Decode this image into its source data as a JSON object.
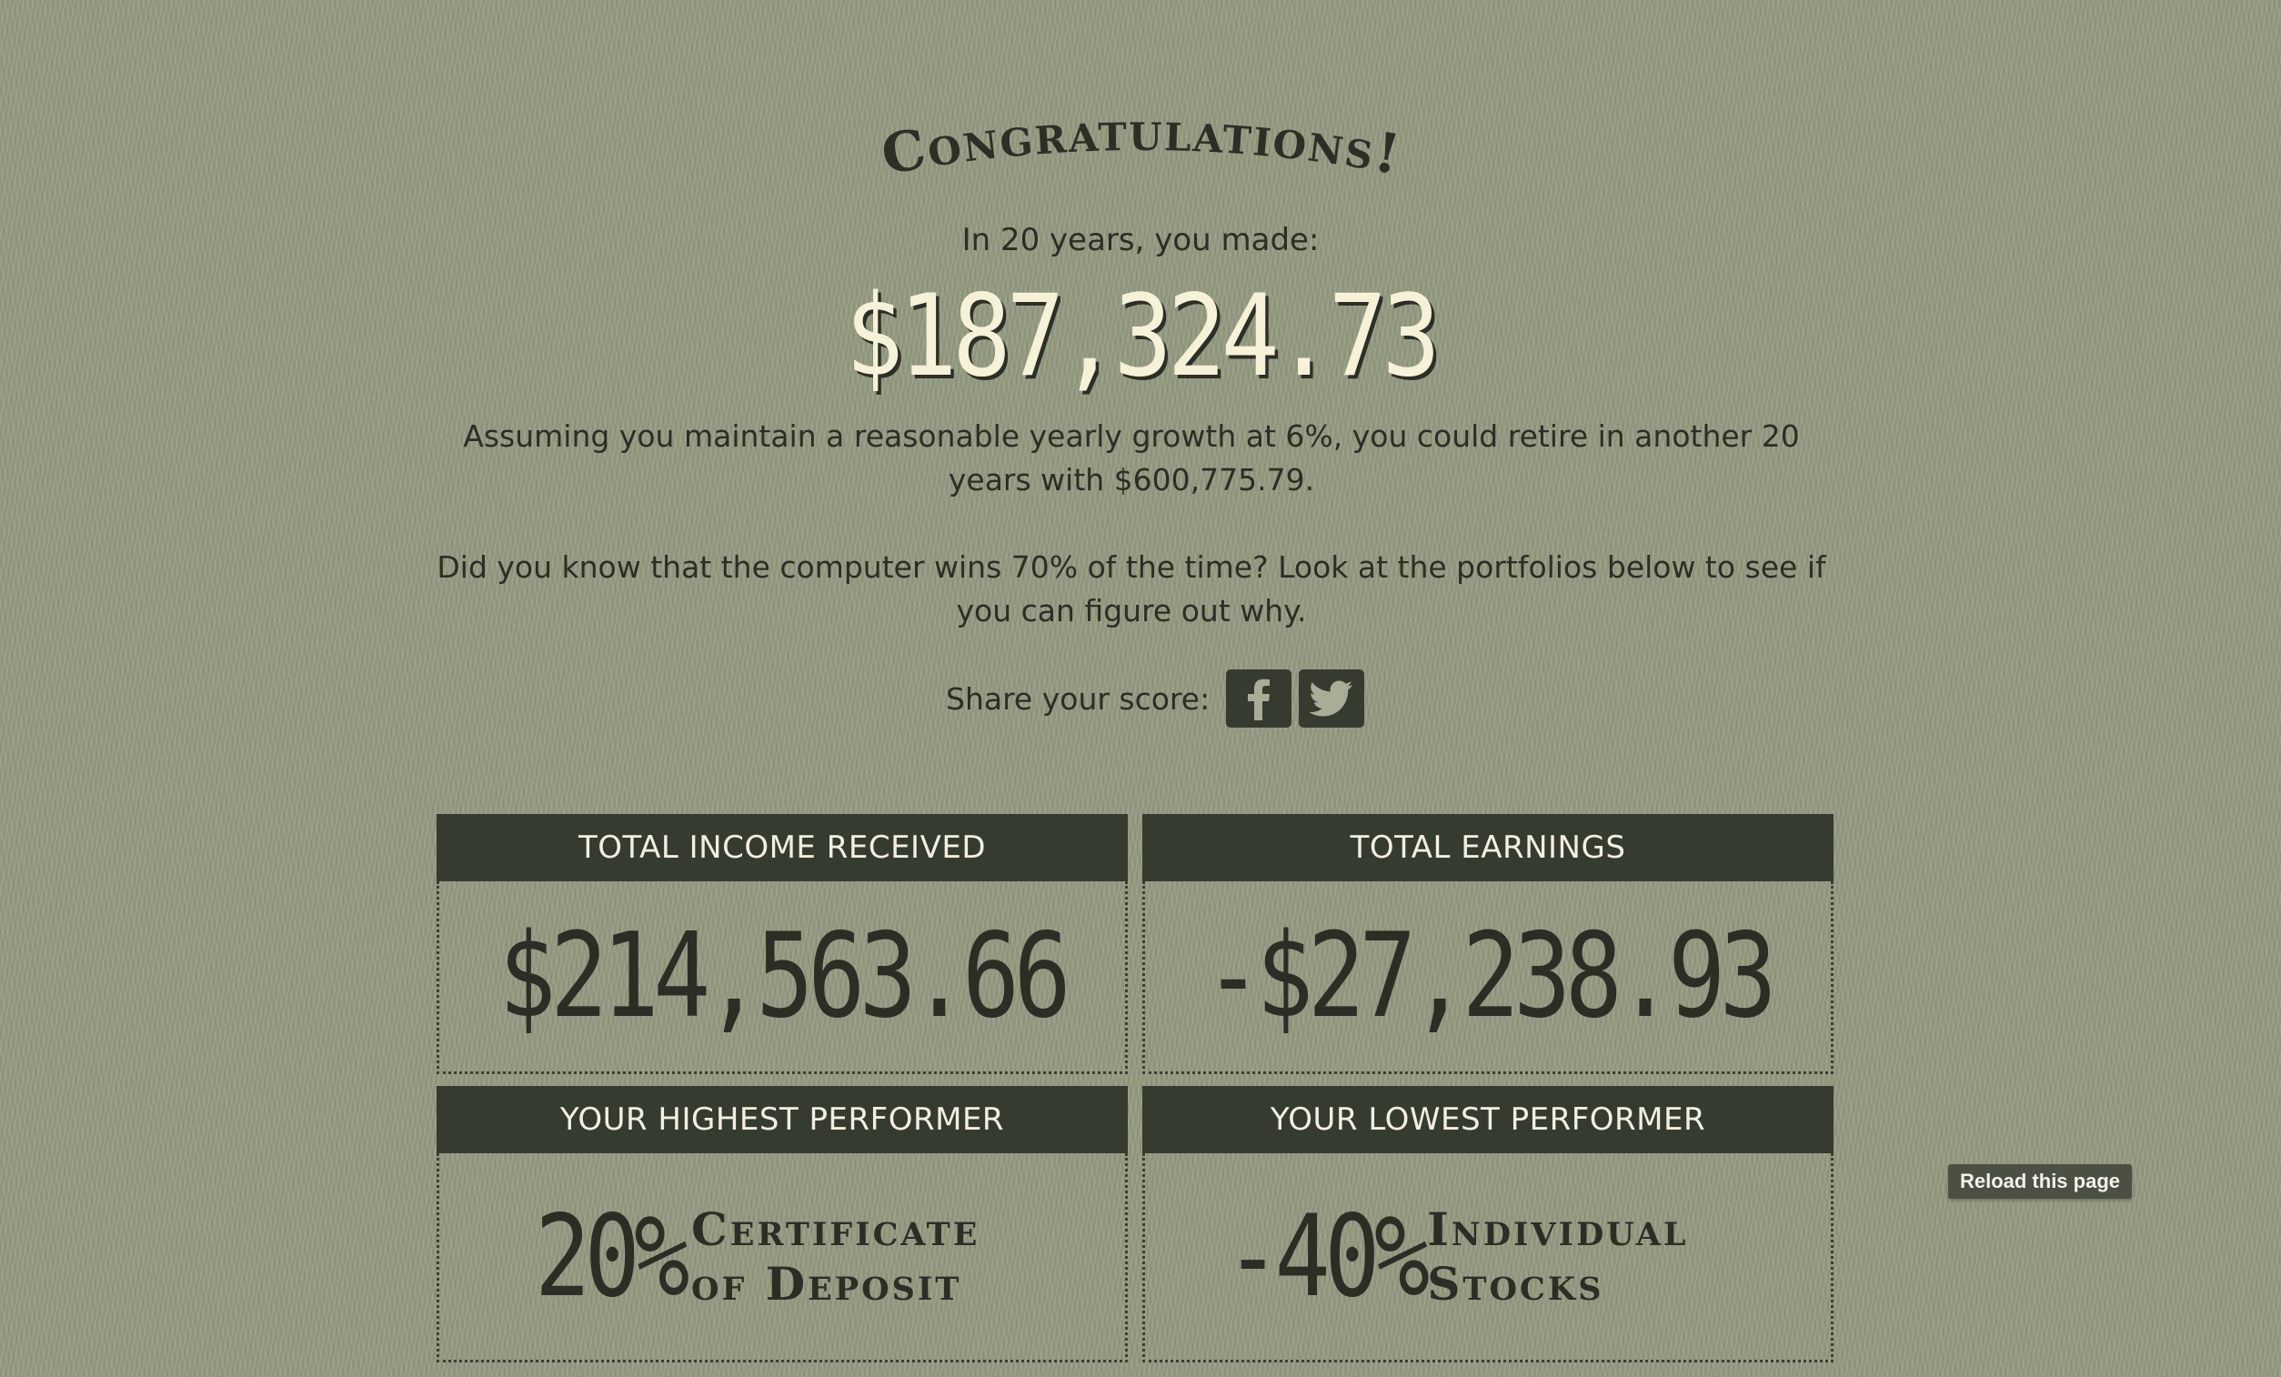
{
  "header": {
    "title": "Congratulations!",
    "subtitle": "In 20 years, you made:",
    "amount": "$187,324.73"
  },
  "summary": {
    "retire_text": "Assuming you maintain a reasonable yearly growth at 6%, you could retire in another 20 years with $600,775.79.",
    "computer_text": "Did you know that the computer wins 70% of the time? Look at the portfolios below to see if you can figure out why."
  },
  "share": {
    "label": "Share your score:",
    "icons": [
      "facebook-icon",
      "twitter-icon"
    ]
  },
  "cards": {
    "income": {
      "title": "TOTAL INCOME RECEIVED",
      "value": "$214,563.66"
    },
    "earnings": {
      "title": "TOTAL EARNINGS",
      "value": "-$27,238.93"
    },
    "highest": {
      "title": "YOUR HIGHEST PERFORMER",
      "percent": "20%",
      "name": "Certificate of Deposit"
    },
    "lowest": {
      "title": "YOUR LOWEST PERFORMER",
      "percent": "-40%",
      "name": "Individual Stocks"
    }
  },
  "reload": {
    "label": "Reload this page"
  },
  "colors": {
    "background": "#949a80",
    "header_bg": "#363b2f",
    "amount_text": "#f6f1d9"
  }
}
